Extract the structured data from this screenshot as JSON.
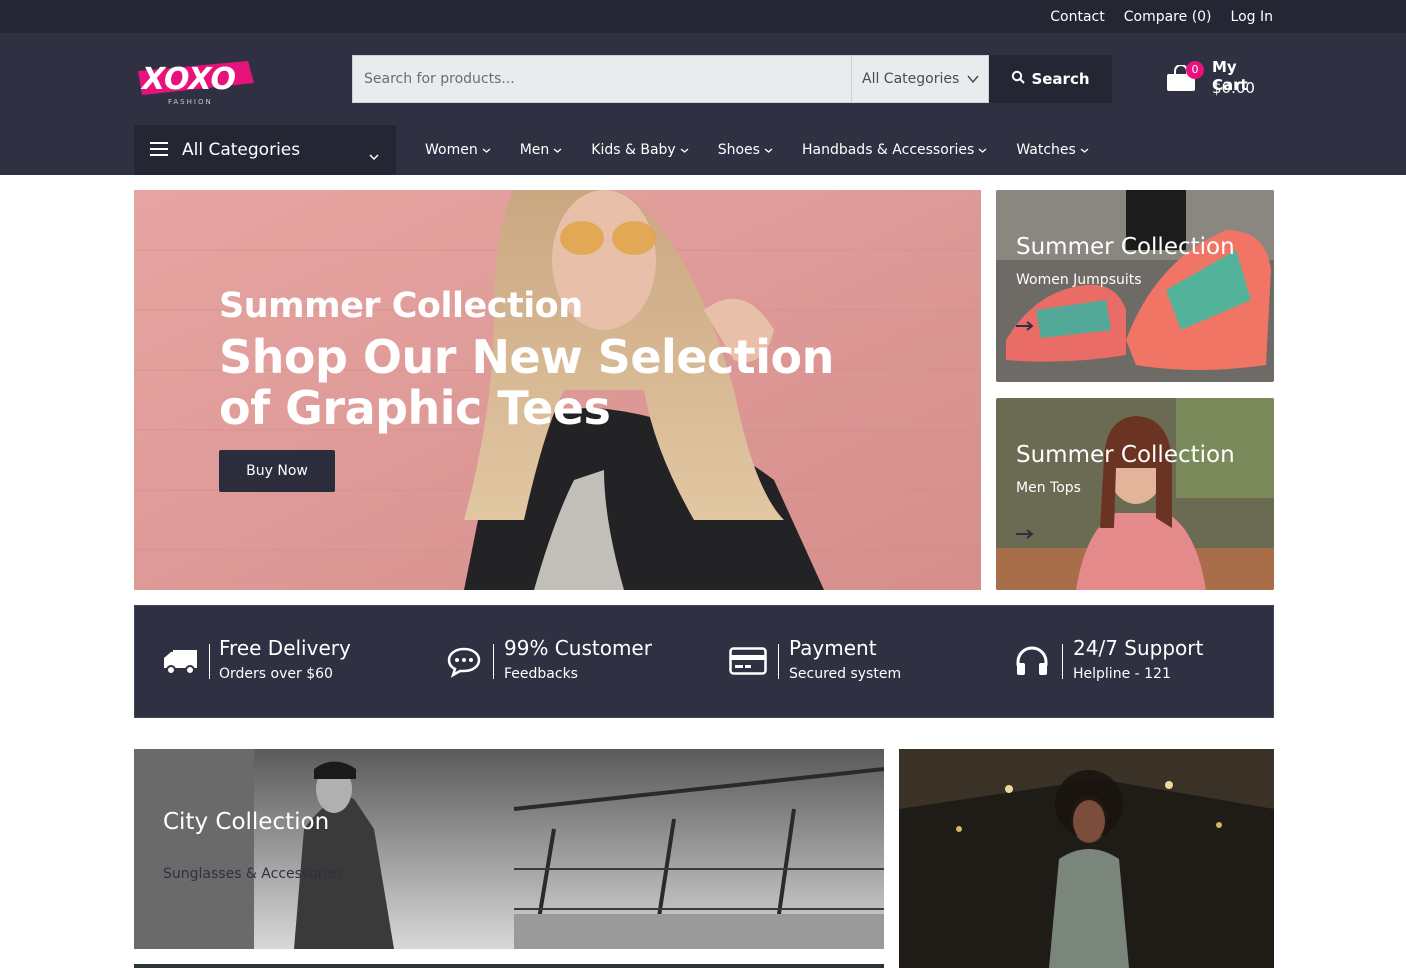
{
  "topbar": {
    "links": [
      "Contact",
      "Compare (0)",
      "Log In"
    ]
  },
  "brand": {
    "logo_text": "XOXO",
    "logo_sub": "FASHION",
    "accent": "#e8127c"
  },
  "search": {
    "placeholder": "Search for products...",
    "category": "All Categories",
    "button": "Search"
  },
  "cart": {
    "count": "0",
    "label": "My Cart",
    "amount": "$0.00"
  },
  "categories_menu": {
    "label": "All Categories"
  },
  "nav": {
    "items": [
      "Women",
      "Men",
      "Kids & Baby",
      "Shoes",
      "Handbads & Accessories",
      "Watches"
    ]
  },
  "hero": {
    "kicker": "Summer Collection",
    "headline": "Shop Our New Selection of Graphic Tees",
    "button": "Buy Now"
  },
  "promos": [
    {
      "title": "Summer Collection",
      "subtitle": "Women Jumpsuits"
    },
    {
      "title": "Summer Collection",
      "subtitle": "Men Tops"
    }
  ],
  "features": [
    {
      "icon": "truck-icon",
      "title": "Free Delivery",
      "subtitle": "Orders over $60"
    },
    {
      "icon": "chat-bubble-icon",
      "title": "99% Customer",
      "subtitle": "Feedbacks"
    },
    {
      "icon": "credit-card-icon",
      "title": "Payment",
      "subtitle": "Secured system"
    },
    {
      "icon": "headphones-icon",
      "title": "24/7 Support",
      "subtitle": "Helpline - 121"
    }
  ],
  "collections": [
    {
      "title": "City Collection",
      "subtitle": "Sunglasses & Accessories"
    }
  ],
  "colors": {
    "topbar": "#242634",
    "header": "#2f3142",
    "accent": "#e8127c"
  }
}
